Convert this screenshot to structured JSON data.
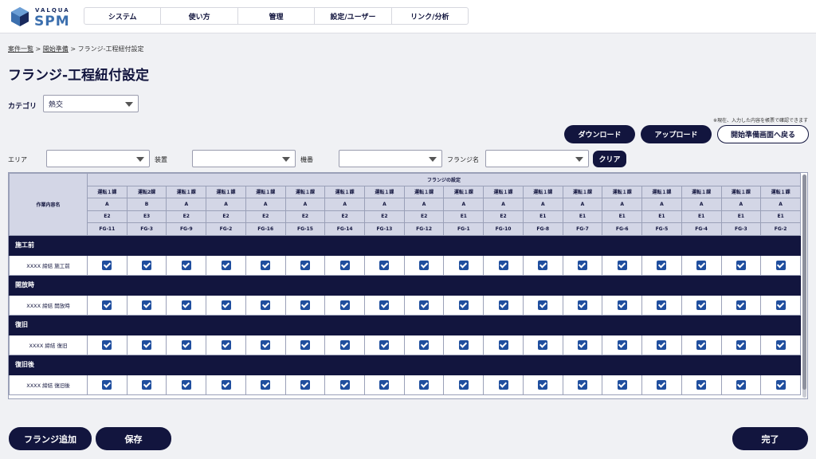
{
  "app": {
    "logo_small": "VALQUA",
    "logo_big": "SPM"
  },
  "nav": [
    "システム",
    "使い方",
    "管理",
    "設定/ユーザー",
    "リンク/分析"
  ],
  "breadcrumb": {
    "item1": "案件一覧",
    "sep": " > ",
    "item2": "開始準備",
    "item3": "フランジ-工程紐付設定"
  },
  "page_title": "フランジ-工程紐付設定",
  "category": {
    "label": "カテゴリ",
    "value": "熱交"
  },
  "note": "※現在、入力した内容を帳票で確認できます",
  "buttons": {
    "download": "ダウンロード",
    "upload": "アップロード",
    "back": "開始準備画面へ戻る",
    "clear": "クリア",
    "add_flange": "フランジ追加",
    "save": "保存",
    "complete": "完了"
  },
  "filters": {
    "area": "エリア",
    "device": "装置",
    "equipment": "機番",
    "flange_name": "フランジ名"
  },
  "table": {
    "corner_label": "作業内容名",
    "group_header": "フランジの設定",
    "row1": [
      "運転１課",
      "運転2課",
      "運転１課",
      "運転１課",
      "運転１課",
      "運転１課",
      "運転１課",
      "運転１課",
      "運転１課",
      "運転１課",
      "運転１課",
      "運転１課",
      "運転１課",
      "運転１課",
      "運転１課",
      "運転１課",
      "運転１課",
      "運転１課"
    ],
    "row2": [
      "A",
      "B",
      "A",
      "A",
      "A",
      "A",
      "A",
      "A",
      "A",
      "A",
      "A",
      "A",
      "A",
      "A",
      "A",
      "A",
      "A",
      "A"
    ],
    "row3": [
      "E2",
      "E3",
      "E2",
      "E2",
      "E2",
      "E2",
      "E2",
      "E2",
      "E2",
      "E1",
      "E2",
      "E1",
      "E1",
      "E1",
      "E1",
      "E1",
      "E1",
      "E1"
    ],
    "row4": [
      "FG-11",
      "FG-3",
      "FG-9",
      "FG-2",
      "FG-16",
      "FG-15",
      "FG-14",
      "FG-13",
      "FG-12",
      "FG-1",
      "FG-10",
      "FG-8",
      "FG-7",
      "FG-6",
      "FG-5",
      "FG-4",
      "FG-3",
      "FG-2"
    ],
    "sections": [
      {
        "name": "施工前",
        "row_label": "XXXX 締結 施工前"
      },
      {
        "name": "開放時",
        "row_label": "XXXX 締結 開放時"
      },
      {
        "name": "復旧",
        "row_label": "XXXX 締結 復旧"
      },
      {
        "name": "復旧後",
        "row_label": "XXXX 締結 復旧後"
      }
    ]
  },
  "colors": {
    "navy": "#12153e",
    "checkbox": "#1f4e9e",
    "header_bg": "#d3d6e6"
  }
}
